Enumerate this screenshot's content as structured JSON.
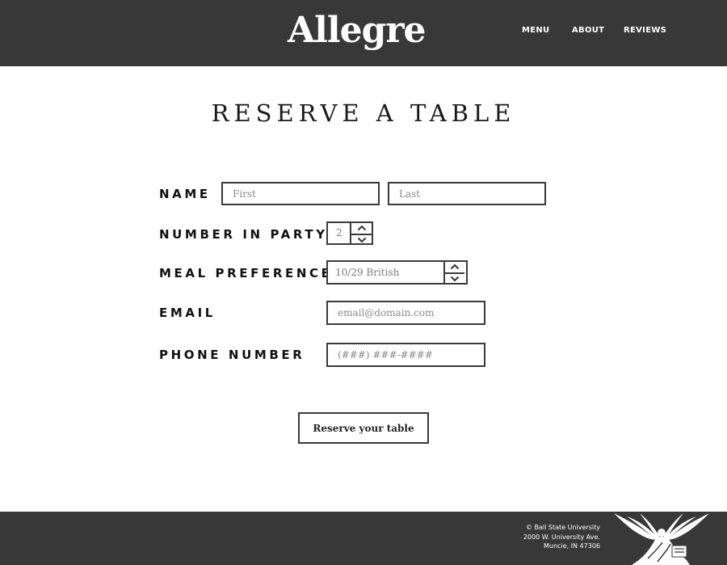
{
  "header": {
    "logo_text": "Allegre",
    "nav": [
      {
        "label": "MENU"
      },
      {
        "label": "ABOUT"
      },
      {
        "label": "REVIEWS"
      }
    ]
  },
  "page": {
    "title": "RESERVE A TABLE"
  },
  "form": {
    "name": {
      "label": "NAME",
      "first_placeholder": "First",
      "last_placeholder": "Last"
    },
    "party": {
      "label": "NUMBER IN PARTY",
      "value": "2"
    },
    "meal": {
      "label": "MEAL PREFERENCE",
      "value": "10/29 British"
    },
    "email": {
      "label": "EMAIL",
      "placeholder": "email@domain.com"
    },
    "phone": {
      "label": "PHONE NUMBER",
      "placeholder": "(###) ###-####"
    },
    "submit_label": "Reserve your table"
  },
  "footer": {
    "address_lines": [
      "© Ball State University",
      "2000 W. University Ave.",
      "Muncie, IN 47306"
    ],
    "emblem_icon": "beneficence-statue-icon"
  }
}
